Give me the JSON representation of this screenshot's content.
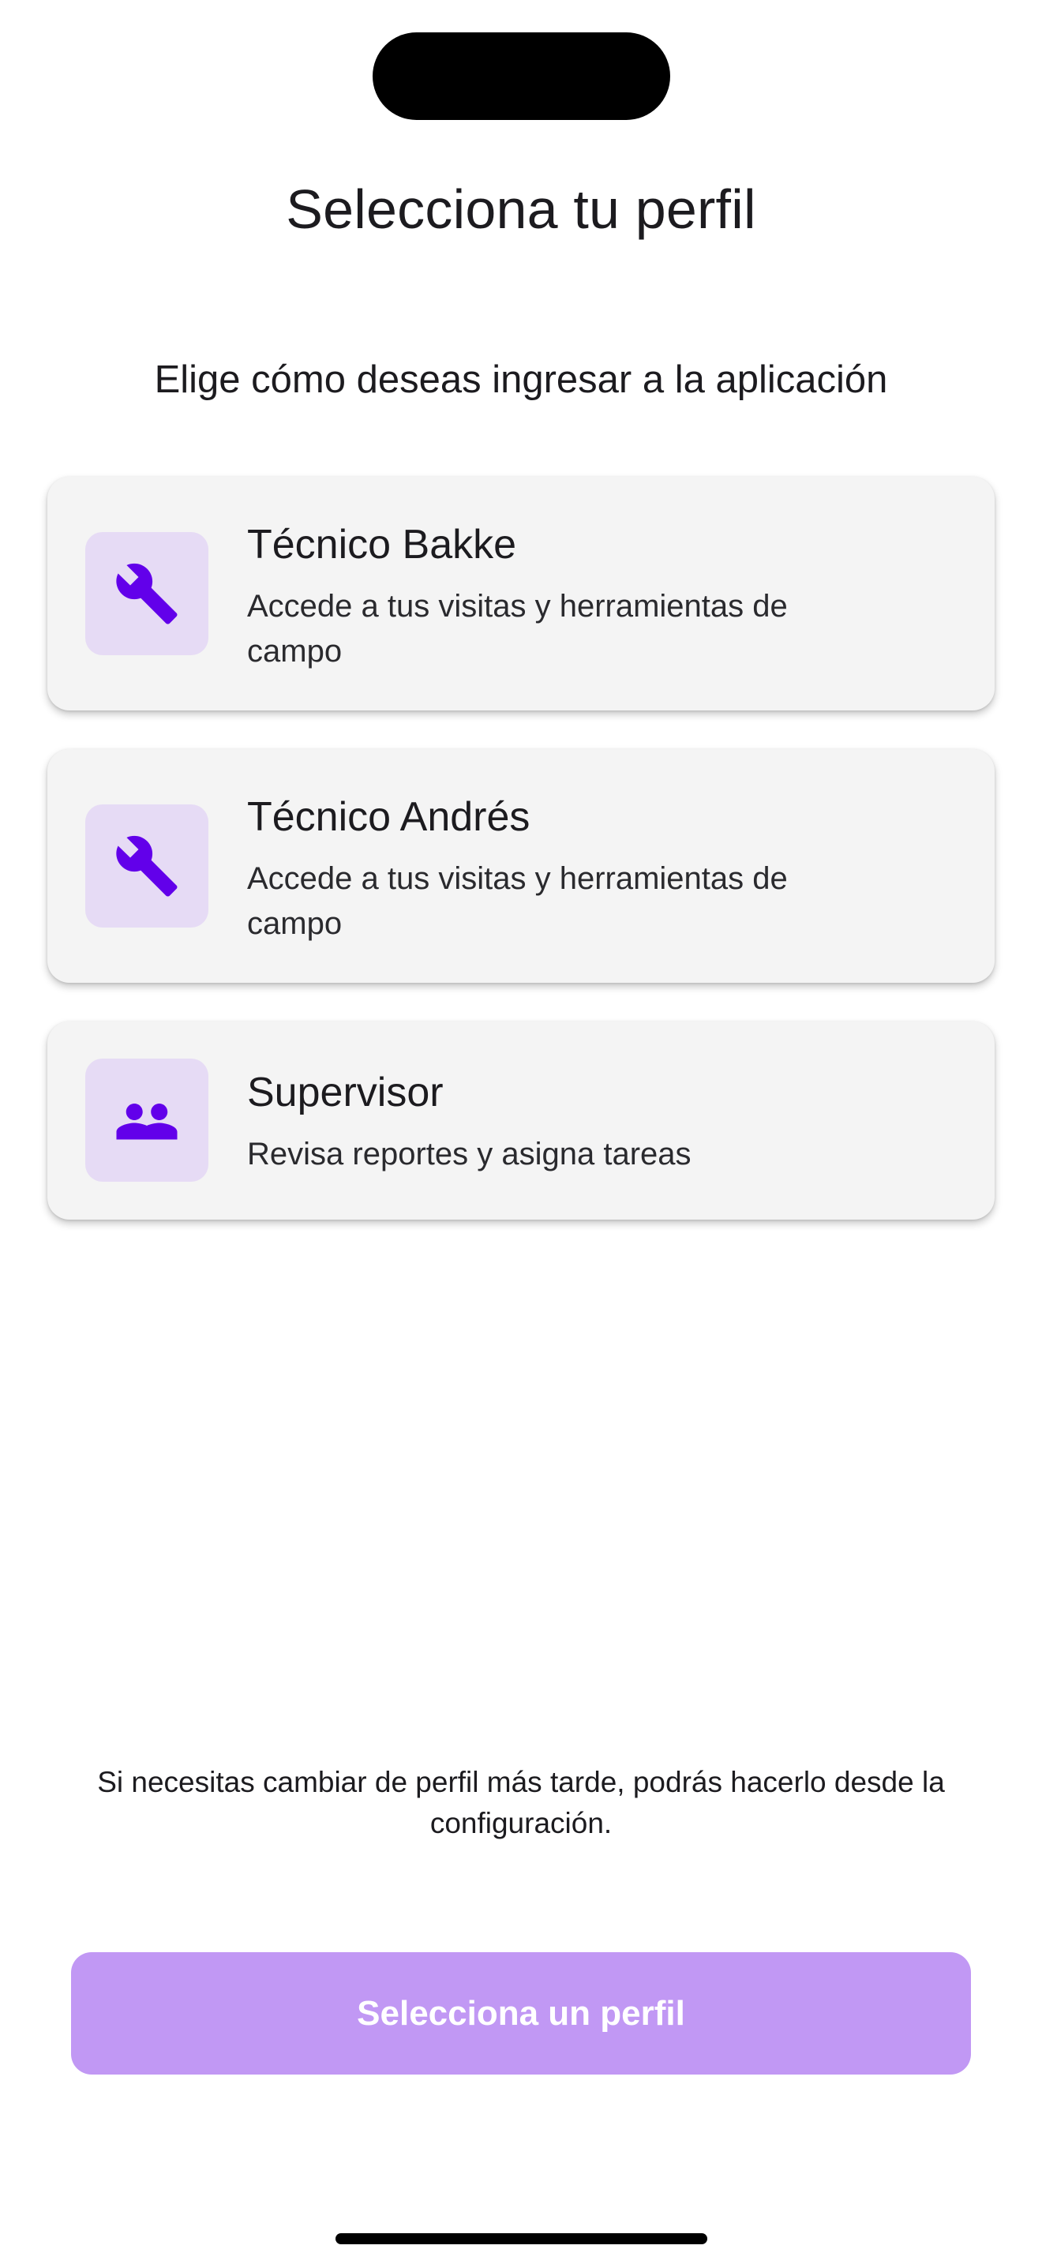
{
  "header": {
    "title": "Selecciona tu perfil",
    "subtitle": "Elige cómo deseas ingresar a la aplicación"
  },
  "profiles": [
    {
      "title": "Técnico Bakke",
      "description": "Accede a tus visitas y herramientas de campo",
      "icon": "wrench-icon"
    },
    {
      "title": "Técnico Andrés",
      "description": "Accede a tus visitas y herramientas de campo",
      "icon": "wrench-icon"
    },
    {
      "title": "Supervisor",
      "description": "Revisa reportes y asigna tareas",
      "icon": "people-icon"
    }
  ],
  "note": "Si necesitas cambiar de perfil más tarde, podrás hacerlo desde la configuración.",
  "cta": {
    "label": "Selecciona un perfil",
    "disabled": true
  },
  "colors": {
    "accent": "#6200ea",
    "icon_background": "#e6dbf5",
    "card_background": "#f4f4f4",
    "button_disabled": "#c198f4"
  }
}
